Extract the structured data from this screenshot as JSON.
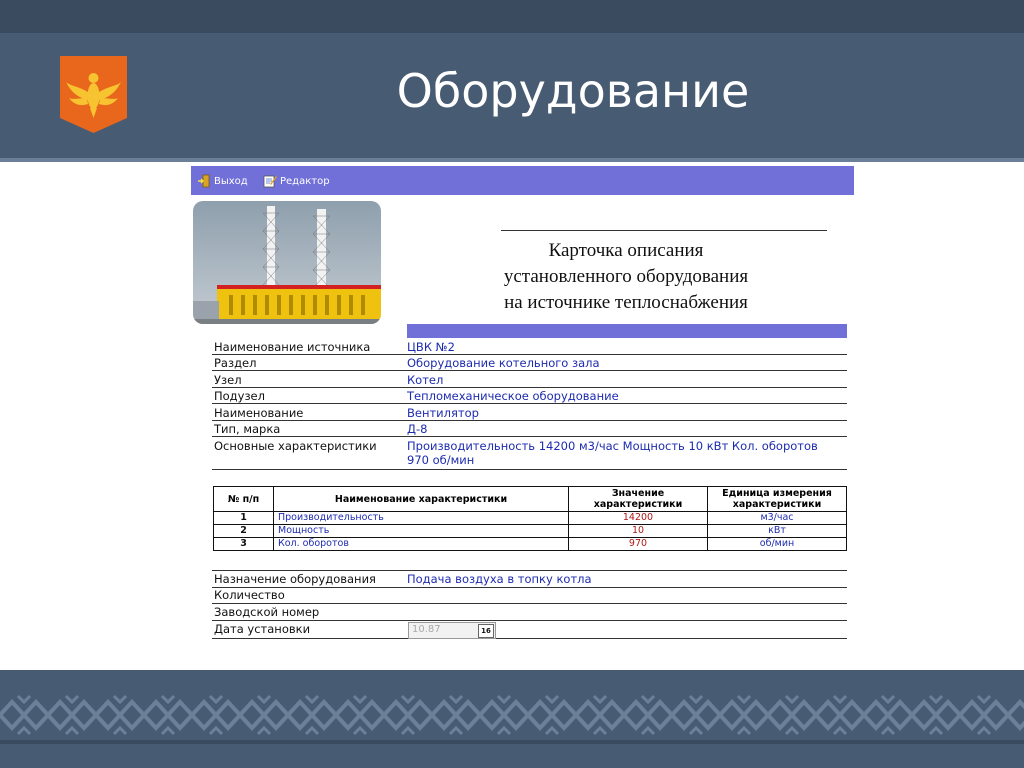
{
  "slide": {
    "title": "Оборудование"
  },
  "toolbar": {
    "exit_label": "Выход",
    "editor_label": "Редактор"
  },
  "card": {
    "title_lines": [
      "Карточка описания",
      "установленного оборудования",
      "на источнике теплоснабжения"
    ]
  },
  "fields": [
    {
      "label": "Наименование источника",
      "value": "ЦВК №2"
    },
    {
      "label": "Раздел",
      "value": "Оборудование котельного зала"
    },
    {
      "label": "Узел",
      "value": "Котел"
    },
    {
      "label": "Подузел",
      "value": "Тепломеханическое оборудование"
    },
    {
      "label": "Наименование",
      "value": "Вентилятор"
    },
    {
      "label": "Тип, марка",
      "value": "Д-8"
    },
    {
      "label": "Основные характеристики",
      "value": "Производительность 14200 м3/час Мощность 10 кВт Кол. оборотов 970 об/мин"
    }
  ],
  "characteristics": {
    "headers": [
      "№ п/п",
      "Наименование характеристики",
      "Значение характеристики",
      "Единица измерения характеристики"
    ],
    "rows": [
      {
        "num": "1",
        "name": "Производительность",
        "value": "14200",
        "unit": "м3/час"
      },
      {
        "num": "2",
        "name": "Мощность",
        "value": "10",
        "unit": "кВт"
      },
      {
        "num": "3",
        "name": "Кол. оборотов",
        "value": "970",
        "unit": "об/мин"
      }
    ]
  },
  "bottom_fields": [
    {
      "label": "Назначение оборудования",
      "value": "Подача воздуха в топку котла"
    },
    {
      "label": "Количество",
      "value": ""
    },
    {
      "label": "Заводской номер",
      "value": ""
    },
    {
      "label": "Дата установки",
      "value": ""
    }
  ],
  "install_date": {
    "value": "10.87",
    "calendar_label": "16"
  },
  "colors": {
    "header": "#475b73",
    "accent_bar": "#7070d8",
    "value_text": "#1d2bb0",
    "number_text": "#b01818",
    "emblem": "#e8671c"
  }
}
